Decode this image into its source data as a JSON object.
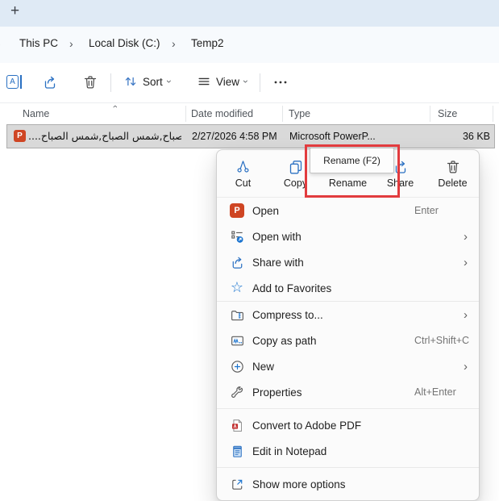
{
  "glyphs": {
    "plus": "+",
    "chevron": "›",
    "letter_a": "A",
    "ppt_p": "P"
  },
  "breadcrumb": {
    "items": [
      "This PC",
      "Local Disk (C:)",
      "Temp2"
    ]
  },
  "command_bar": {
    "sort_label": "Sort",
    "view_label": "View"
  },
  "file_list": {
    "columns": [
      "Name",
      "Date modified",
      "Type",
      "Size"
    ],
    "rows": [
      {
        "icon": "powerpoint-file-icon",
        "name": "....شمس الصباح,شمس الصباح,شمس الصباح",
        "date_modified": "2/27/2026 4:58 PM",
        "type": "Microsoft PowerP...",
        "size": "36 KB",
        "selected": true
      }
    ]
  },
  "rename_tooltip": {
    "text": "Rename (F2)"
  },
  "context_menu": {
    "toolbar": [
      {
        "label": "Cut",
        "icon": "cut-icon"
      },
      {
        "label": "Copy",
        "icon": "copy-icon"
      },
      {
        "label": "Rename",
        "icon": "rename-icon"
      },
      {
        "label": "Share",
        "icon": "share-icon"
      },
      {
        "label": "Delete",
        "icon": "delete-icon"
      }
    ],
    "items": [
      {
        "label": "Open",
        "shortcut": "Enter",
        "icon": "powerpoint-icon"
      },
      {
        "label": "Open with",
        "submenu": true,
        "icon": "open-with-icon"
      },
      {
        "label": "Share with",
        "submenu": true,
        "icon": "share-with-icon"
      },
      {
        "label": "Add to Favorites",
        "icon": "favorites-star-icon"
      },
      {
        "label": "Compress to...",
        "submenu": true,
        "icon": "compress-to-icon"
      },
      {
        "label": "Copy as path",
        "shortcut": "Ctrl+Shift+C",
        "icon": "copy-as-path-icon"
      },
      {
        "label": "New",
        "submenu": true,
        "icon": "new-icon"
      },
      {
        "label": "Properties",
        "shortcut": "Alt+Enter",
        "icon": "properties-icon"
      },
      {
        "label": "Convert to Adobe PDF",
        "icon": "adobe-pdf-icon"
      },
      {
        "label": "Edit in Notepad",
        "icon": "notepad-icon"
      },
      {
        "label": "Show more options",
        "icon": "show-more-options-icon"
      }
    ]
  },
  "colors": {
    "accent_blue": "#1b74cf",
    "highlight_red": "#e23b3e",
    "selected_row": "#d9d9d9",
    "tab_bar_bg": "#dfeaf5",
    "powerpoint_red": "#cf4523"
  }
}
